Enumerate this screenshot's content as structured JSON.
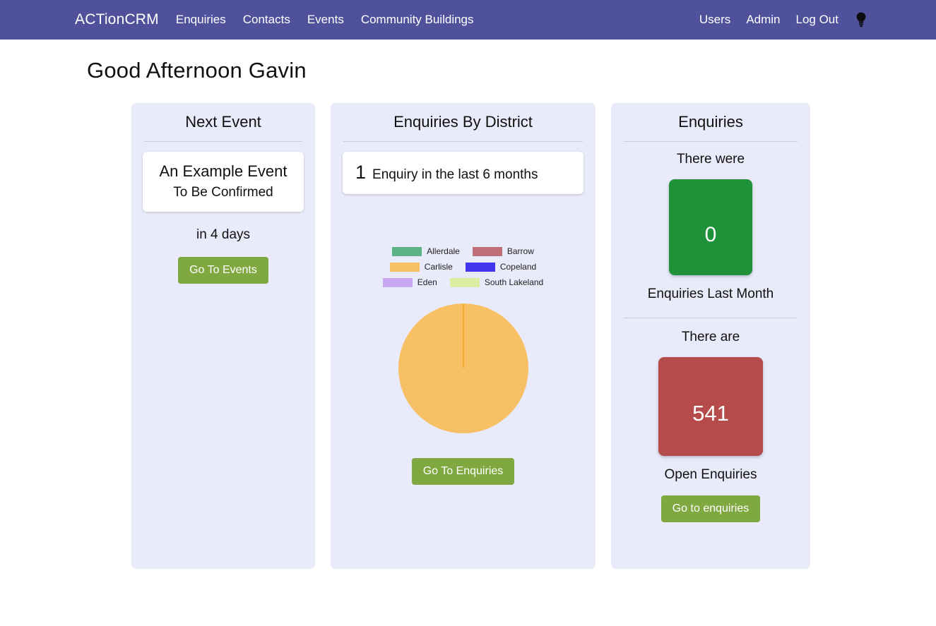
{
  "navbar": {
    "brand": "ACTionCRM",
    "left_links": [
      {
        "label": "Enquiries"
      },
      {
        "label": "Contacts"
      },
      {
        "label": "Events"
      },
      {
        "label": "Community Buildings"
      }
    ],
    "right_links": [
      {
        "label": "Users"
      },
      {
        "label": "Admin"
      },
      {
        "label": "Log Out"
      }
    ],
    "icon": "lightbulb-icon",
    "bg_color": "#50519b"
  },
  "page": {
    "greeting": "Good Afternoon Gavin",
    "bg_color": "#ffffff",
    "card_bg_color": "#e9eafa"
  },
  "next_event_card": {
    "title": "Next Event",
    "event_name": "An Example Event",
    "event_status": "To Be Confirmed",
    "event_when": "in 4 days",
    "button_label": "Go To Events",
    "button_color": "#80a840"
  },
  "district_card": {
    "title": "Enquiries By District",
    "count_number": "1",
    "count_text": "Enquiry in the last 6 months",
    "button_label": "Go To Enquiries",
    "button_color": "#80a840"
  },
  "enquiries_card": {
    "title": "Enquiries",
    "last_month_caption": "There were",
    "last_month_value": "0",
    "last_month_label": "Enquiries Last Month",
    "last_month_color": "#1f9139",
    "open_caption": "There are",
    "open_value": "541",
    "open_label": "Open Enquiries",
    "open_color": "#b54b4b",
    "button_label": "Go to enquiries",
    "button_color": "#80a840"
  },
  "chart_data": {
    "type": "pie",
    "title": "Enquiries By District",
    "categories": [
      "Allerdale",
      "Barrow",
      "Carlisle",
      "Copeland",
      "Eden",
      "South Lakeland"
    ],
    "values": [
      0,
      0,
      1,
      0,
      0,
      0
    ],
    "colors": [
      "#5cb185",
      "#bf6e77",
      "#f8c064",
      "#4237ee",
      "#c9a8f2",
      "#dbeda0"
    ],
    "legend_position": "top",
    "total": 1,
    "note": "Single slice: Carlisle = 100%"
  }
}
